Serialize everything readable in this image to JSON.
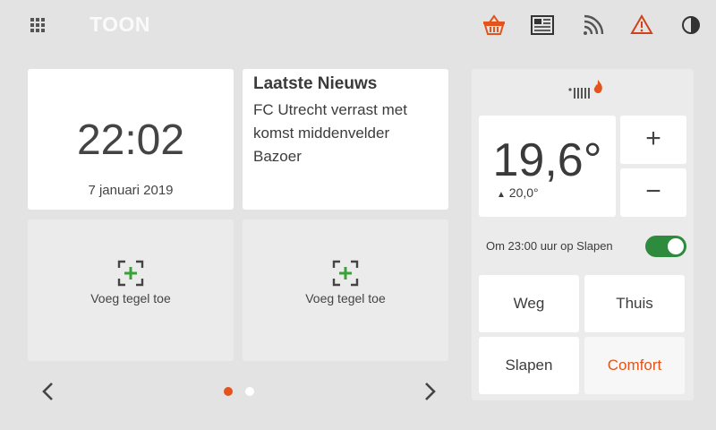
{
  "topbar": {
    "logo": "TOON",
    "icons": [
      "apps-grid-icon",
      "basket-icon",
      "newspaper-icon",
      "wifi-icon",
      "warning-icon",
      "contrast-icon"
    ],
    "accent_color": "#e2541b"
  },
  "clock": {
    "time": "22:02",
    "date": "7 januari 2019"
  },
  "news": {
    "title": "Laatste Nieuws",
    "body": "FC Utrecht verrast met komst middenvelder Bazoer"
  },
  "add_tiles": [
    {
      "label": "Voeg tegel toe"
    },
    {
      "label": "Voeg tegel toe"
    }
  ],
  "pager": {
    "current_page": 1,
    "total_pages": 2
  },
  "thermostat": {
    "temperature": "19,6°",
    "setpoint": "20,0°",
    "plus": "+",
    "minus": "−",
    "schedule_text": "Om 23:00 uur op Slapen",
    "schedule_enabled": true,
    "programs": [
      "Weg",
      "Thuis",
      "Slapen",
      "Comfort"
    ],
    "active_program": "Comfort"
  }
}
